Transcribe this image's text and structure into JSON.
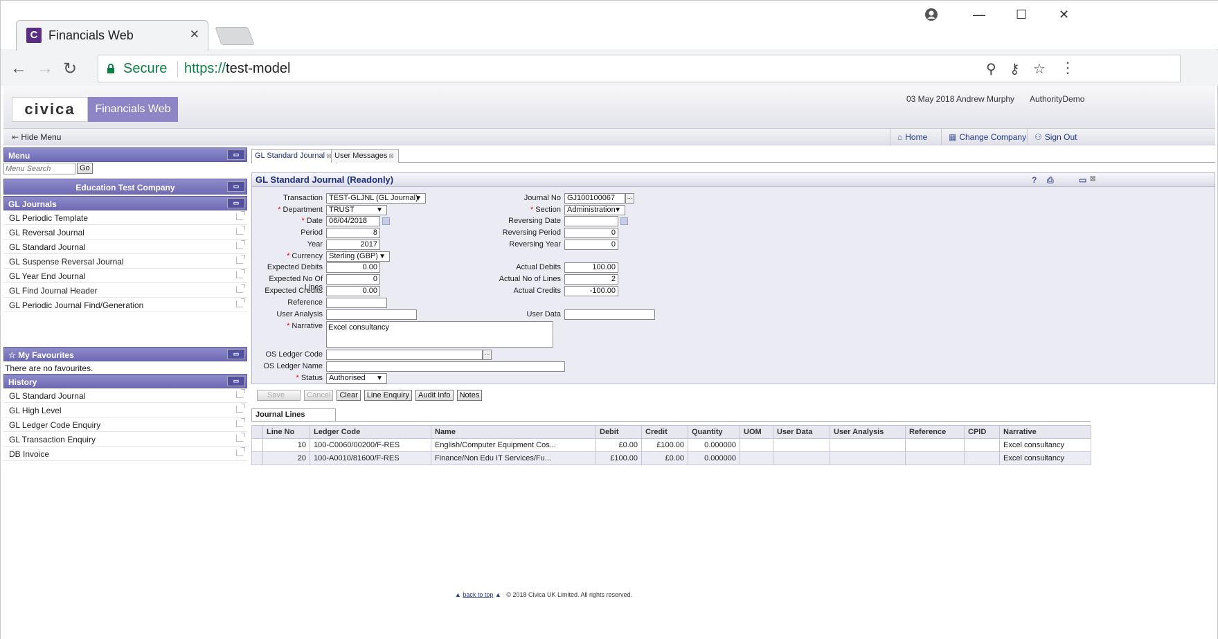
{
  "browser": {
    "tab_title": "Financials Web",
    "tab_logo": "C",
    "tab_close": "✕",
    "secure_label": "Secure",
    "url_scheme": "https://",
    "url_host": "test-model"
  },
  "header": {
    "logo_text": "civica",
    "brand": "Financials Web",
    "date": "03 May 2018",
    "user": "Andrew Murphy",
    "authority": "AuthorityDemo"
  },
  "menubar": {
    "hide_menu": "Hide Menu",
    "home": "Home",
    "change_company": "Change Company",
    "sign_out": "Sign Out"
  },
  "sidebar": {
    "menu_title": "Menu",
    "search_placeholder": "Menu Search",
    "go_label": "Go",
    "company": "Education Test Company",
    "section_title": "GL Journals",
    "items": [
      {
        "label": "GL Periodic Template"
      },
      {
        "label": "GL Reversal Journal"
      },
      {
        "label": "GL Standard Journal"
      },
      {
        "label": "GL Suspense Reversal Journal"
      },
      {
        "label": "GL Year End Journal"
      },
      {
        "label": "GL Find Journal Header"
      },
      {
        "label": "GL Periodic Journal Find/Generation"
      }
    ],
    "favourites_title": "My Favourites",
    "favourites_empty": "There are no favourites.",
    "history_title": "History",
    "history": [
      {
        "label": "GL Standard Journal"
      },
      {
        "label": "GL High Level"
      },
      {
        "label": "GL Ledger Code Enquiry"
      },
      {
        "label": "GL Transaction Enquiry"
      },
      {
        "label": "DB Invoice"
      }
    ]
  },
  "tabs": [
    {
      "label": "GL Standard Journal"
    },
    {
      "label": "User Messages"
    }
  ],
  "form": {
    "title": "GL Standard Journal (Readonly)",
    "labels": {
      "transaction": "Transaction",
      "department": "Department",
      "date": "Date",
      "period": "Period",
      "year": "Year",
      "currency": "Currency",
      "expected_debits": "Expected Debits",
      "expected_lines": "Expected No Of Lines",
      "expected_credits": "Expected Credits",
      "reference": "Reference",
      "user_analysis": "User Analysis",
      "narrative": "Narrative",
      "os_ledger_code": "OS Ledger Code",
      "os_ledger_name": "OS Ledger Name",
      "status": "Status",
      "journal_no": "Journal No",
      "section": "Section",
      "reversing_date": "Reversing Date",
      "reversing_period": "Reversing Period",
      "reversing_year": "Reversing Year",
      "actual_debits": "Actual Debits",
      "actual_lines": "Actual No of Lines",
      "actual_credits": "Actual Credits",
      "user_data": "User Data"
    },
    "values": {
      "transaction": "TEST-GLJNL (GL Journal)",
      "department": "TRUST",
      "date": "06/04/2018",
      "period": "8",
      "year": "2017",
      "currency": "Sterling (GBP)",
      "expected_debits": "0.00",
      "expected_lines": "0",
      "expected_credits": "0.00",
      "reference": "",
      "user_analysis": "",
      "narrative": "Excel consultancy",
      "os_ledger_code": "",
      "os_ledger_name": "",
      "status": "Authorised",
      "journal_no": "GJ100100067",
      "section": "Administration",
      "reversing_date": "",
      "reversing_period": "0",
      "reversing_year": "0",
      "actual_debits": "100.00",
      "actual_lines": "2",
      "actual_credits": "-100.00",
      "user_data": ""
    }
  },
  "actions": {
    "save": "Save",
    "cancel": "Cancel",
    "clear": "Clear",
    "line_enquiry": "Line Enquiry",
    "audit_info": "Audit Info",
    "notes": "Notes"
  },
  "journal_lines": {
    "tab_label": "Journal Lines",
    "columns": [
      "Line No",
      "Ledger Code",
      "Name",
      "Debit",
      "Credit",
      "Quantity",
      "UOM",
      "User Data",
      "User Analysis",
      "Reference",
      "CPID",
      "Narrative"
    ],
    "rows": [
      {
        "line_no": "10",
        "ledger_code": "100-C0060/00200/F-RES",
        "name": "English/Computer Equipment Cos...",
        "debit": "£0.00",
        "credit": "£100.00",
        "quantity": "0.000000",
        "uom": "",
        "user_data": "",
        "user_analysis": "",
        "reference": "",
        "cpid": "",
        "narrative": "Excel consultancy"
      },
      {
        "line_no": "20",
        "ledger_code": "100-A0010/81600/F-RES",
        "name": "Finance/Non Edu IT Services/Fu...",
        "debit": "£100.00",
        "credit": "£0.00",
        "quantity": "0.000000",
        "uom": "",
        "user_data": "",
        "user_analysis": "",
        "reference": "",
        "cpid": "",
        "narrative": "Excel consultancy"
      }
    ]
  },
  "footer": {
    "back_to_top": "back to top",
    "copyright": "© 2018 Civica UK Limited. All rights reserved."
  }
}
